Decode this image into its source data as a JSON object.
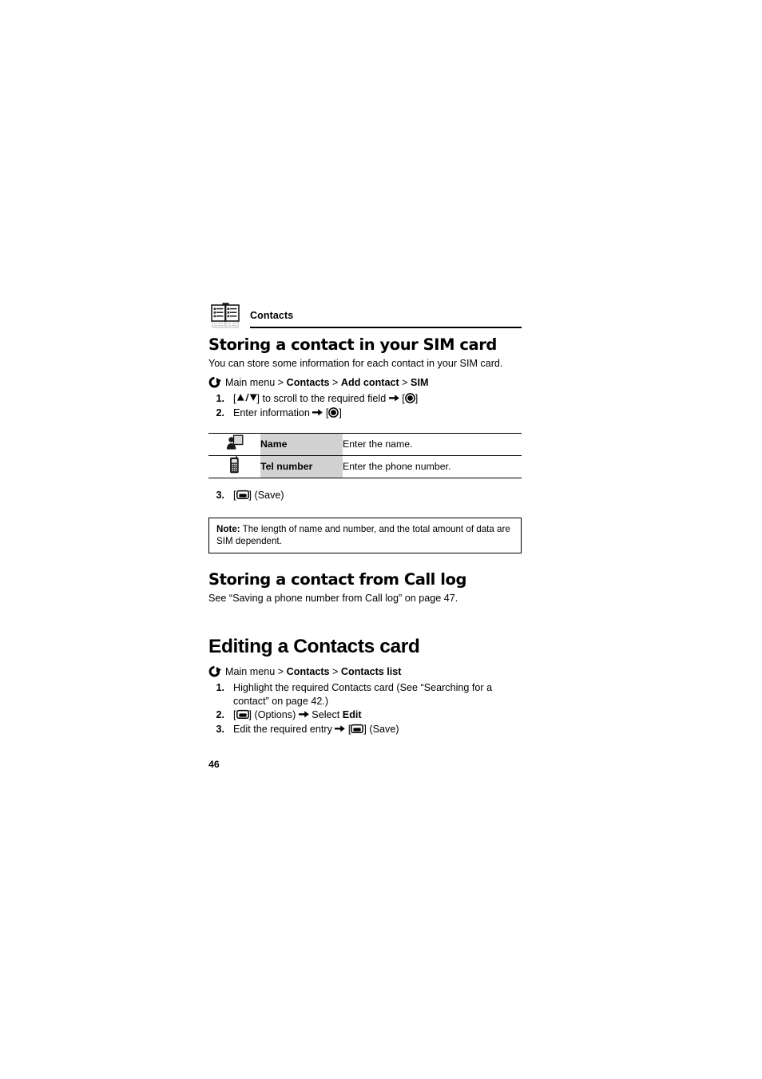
{
  "page": {
    "folio": "46",
    "running_header": {
      "icon": "address-book-icon",
      "title": "Contacts"
    }
  },
  "sections": [
    {
      "id": "storing-sim",
      "heading": "Storing a contact in your SIM card",
      "intro": "You can store some information for each contact in your SIM card.",
      "nav_path": {
        "icon": "loop-arrow-icon",
        "prefix": "Main menu",
        "sep": " > ",
        "parts": [
          "Contacts",
          "Add contact",
          "SIM"
        ]
      },
      "steps": [
        {
          "num": "1.",
          "pre": "[",
          "key": "updown-nav-key-icon",
          "post": "] to scroll to the required field ",
          "arrow": "right-arrow-icon",
          "tail_pre": " [",
          "tail_key": "select-key-icon",
          "tail_post": "]"
        },
        {
          "num": "2.",
          "pre": "Enter information ",
          "arrow": "right-arrow-icon",
          "tail_pre": " [",
          "tail_key": "select-key-icon",
          "tail_post": "]"
        }
      ],
      "table": {
        "rows": [
          {
            "icon": "contact-card-icon",
            "label": "Name",
            "description": "Enter the name."
          },
          {
            "icon": "mobile-phone-icon",
            "label": "Tel number",
            "description": "Enter the phone number."
          }
        ]
      },
      "step_after_table": {
        "num": "3.",
        "pre": "[",
        "key": "softkey-icon",
        "post": "] (Save)"
      },
      "note": {
        "label": "Note:",
        "text": "The length of name and number, and the total amount of data are SIM dependent."
      }
    },
    {
      "id": "storing-call-log",
      "heading": "Storing a contact from Call log",
      "body": "See “Saving a phone number from Call log” on page 47."
    },
    {
      "id": "editing-contacts-card",
      "heading": "Editing a Contacts card",
      "nav_path": {
        "icon": "loop-arrow-icon",
        "prefix": "Main menu",
        "sep": " > ",
        "parts": [
          "Contacts",
          "Contacts list"
        ]
      },
      "steps": [
        {
          "num": "1.",
          "text": "Highlight the required Contacts card (See “Searching for a contact” on page 42.)"
        },
        {
          "num": "2.",
          "pre": "[",
          "key": "softkey-icon",
          "mid": "] (Options) ",
          "arrow": "right-arrow-icon",
          "tail": " Select ",
          "bold_tail": "Edit"
        },
        {
          "num": "3.",
          "pre": "Edit the required entry ",
          "arrow": "right-arrow-icon",
          "mid": " [",
          "key": "softkey-icon",
          "tail": "] (Save)"
        }
      ]
    }
  ],
  "colors": {
    "label_cell_bg": "#d2d2d2",
    "rule": "#000000",
    "text": "#000000",
    "page_bg": "#ffffff"
  }
}
